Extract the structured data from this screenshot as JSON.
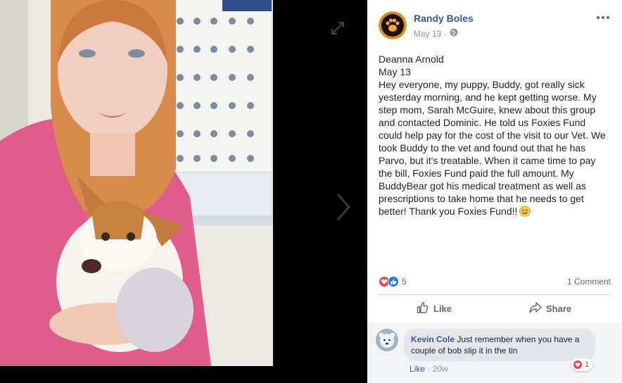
{
  "post": {
    "author": "Randy Boles",
    "date": "May 13",
    "separator": "·",
    "privacy_icon": "globe-icon",
    "more_icon": "ellipsis-icon",
    "text_lines": [
      "Deanna Arnold",
      "May 13",
      "Hey everyone, my puppy, Buddy, got really sick",
      "yesterday morning, and he kept getting worse. My",
      "step mom, Sarah McGuire, knew about this group",
      "and contacted Dominic. He told us Foxies Fund",
      "could help pay for the cost of the visit to our Vet. We",
      "took Buddy to the vet and found out that he has",
      "Parvo, but it's treatable. When it came time to pay",
      "the bill, Foxies Fund paid the full amount. My",
      "BuddyBear got his medical treatment as well as",
      "prescriptions to take home that he needs to get",
      "better! Thank you Foxies Fund!!"
    ],
    "reaction_count": "5",
    "comment_count": "1 Comment",
    "actions": {
      "like": "Like",
      "share": "Share"
    }
  },
  "comment": {
    "author": "Kevin Cole",
    "text": "Just remember when you have a couple of bob slip it in the tin",
    "like": "Like",
    "separator": "·",
    "time": "20w",
    "reaction_count": "1"
  },
  "colors": {
    "link": "#365899",
    "muted": "#90949c",
    "like_blue": "#1877f2",
    "love_red": "#f33e58"
  }
}
